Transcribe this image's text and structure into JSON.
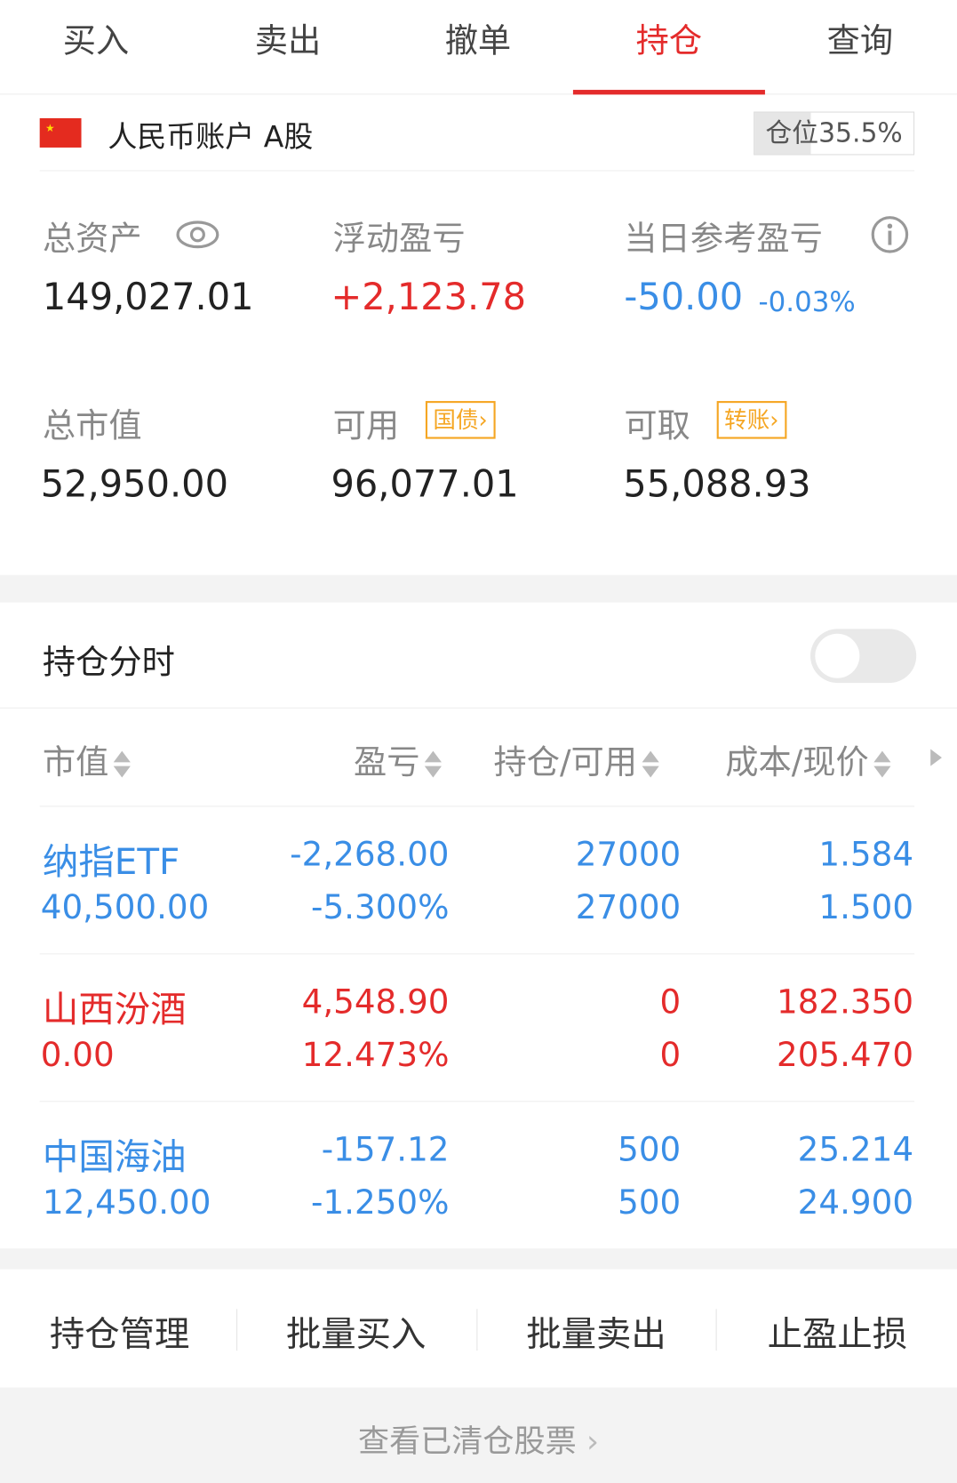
{
  "tabs": [
    "买入",
    "卖出",
    "撤单",
    "持仓",
    "查询"
  ],
  "account": {
    "name": "人民币账户 A股",
    "position_label": "仓位35.5%",
    "position_ratio": 0.355
  },
  "summary": {
    "total_assets_label": "总资产",
    "total_assets": "149,027.01",
    "float_pnl_label": "浮动盈亏",
    "float_pnl": "+2,123.78",
    "day_pnl_label": "当日参考盈亏",
    "day_pnl": "-50.00",
    "day_pnl_pct": "-0.03%",
    "market_value_label": "总市值",
    "market_value": "52,950.00",
    "available_label": "可用",
    "available_tag": "国债",
    "available": "96,077.01",
    "withdrawable_label": "可取",
    "withdrawable_tag": "转账",
    "withdrawable": "55,088.93"
  },
  "intraday": {
    "title": "持仓分时",
    "enabled": false
  },
  "table": {
    "headers": [
      "市值",
      "盈亏",
      "持仓/可用",
      "成本/现价"
    ],
    "rows": [
      {
        "name": "纳指ETF",
        "market_value": "40,500.00",
        "pnl": "-2,268.00",
        "pnl_pct": "-5.300%",
        "hold": "27000",
        "avail": "27000",
        "cost": "1.584",
        "price": "1.500",
        "tone": "down"
      },
      {
        "name": "山西汾酒",
        "market_value": "0.00",
        "pnl": "4,548.90",
        "pnl_pct": "12.473%",
        "hold": "0",
        "avail": "0",
        "cost": "182.350",
        "price": "205.470",
        "tone": "up"
      },
      {
        "name": "中国海油",
        "market_value": "12,450.00",
        "pnl": "-157.12",
        "pnl_pct": "-1.250%",
        "hold": "500",
        "avail": "500",
        "cost": "25.214",
        "price": "24.900",
        "tone": "down"
      }
    ]
  },
  "actions": [
    "持仓管理",
    "批量买入",
    "批量卖出",
    "止盈止损"
  ],
  "footer": {
    "text": "查看已清仓股票"
  },
  "colors": {
    "up": "#e42b2b",
    "down": "#3a8ee6",
    "accent": "#e42b2b",
    "tag": "#f5a623"
  },
  "icons": {
    "visibility": "eye-icon",
    "info": "info-icon",
    "flag": "china-flag-icon"
  }
}
